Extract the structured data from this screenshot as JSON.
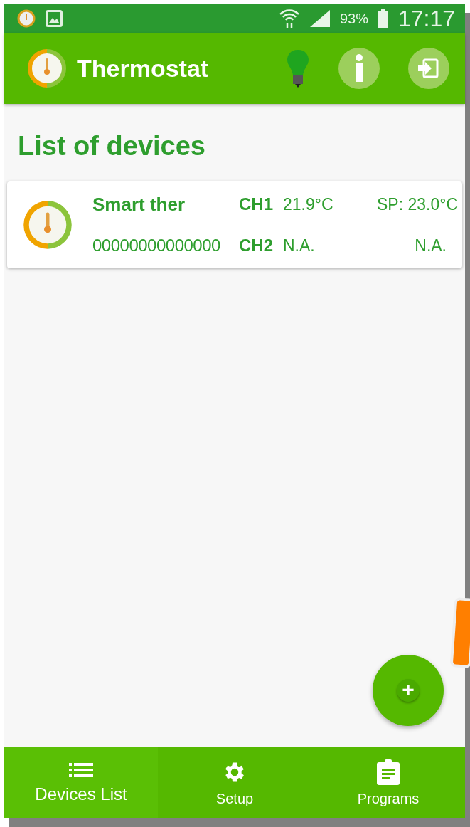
{
  "status_bar": {
    "battery": "93%",
    "time": "17:17"
  },
  "app_bar": {
    "title": "Thermostat"
  },
  "heading": "List of devices",
  "devices": [
    {
      "name": "Smart ther",
      "serial": "00000000000000",
      "channels": [
        {
          "label": "CH1",
          "temperature": "21.9°C",
          "setpoint": "SP: 23.0°C"
        },
        {
          "label": "CH2",
          "temperature": "N.A.",
          "setpoint": "N.A."
        }
      ]
    }
  ],
  "fab": {
    "label": "+"
  },
  "bottom_nav": [
    {
      "label": "Devices List",
      "kind": "list",
      "selected": true
    },
    {
      "label": "Setup",
      "kind": "gear",
      "selected": false
    },
    {
      "label": "Programs",
      "kind": "clipboard",
      "selected": false
    }
  ]
}
